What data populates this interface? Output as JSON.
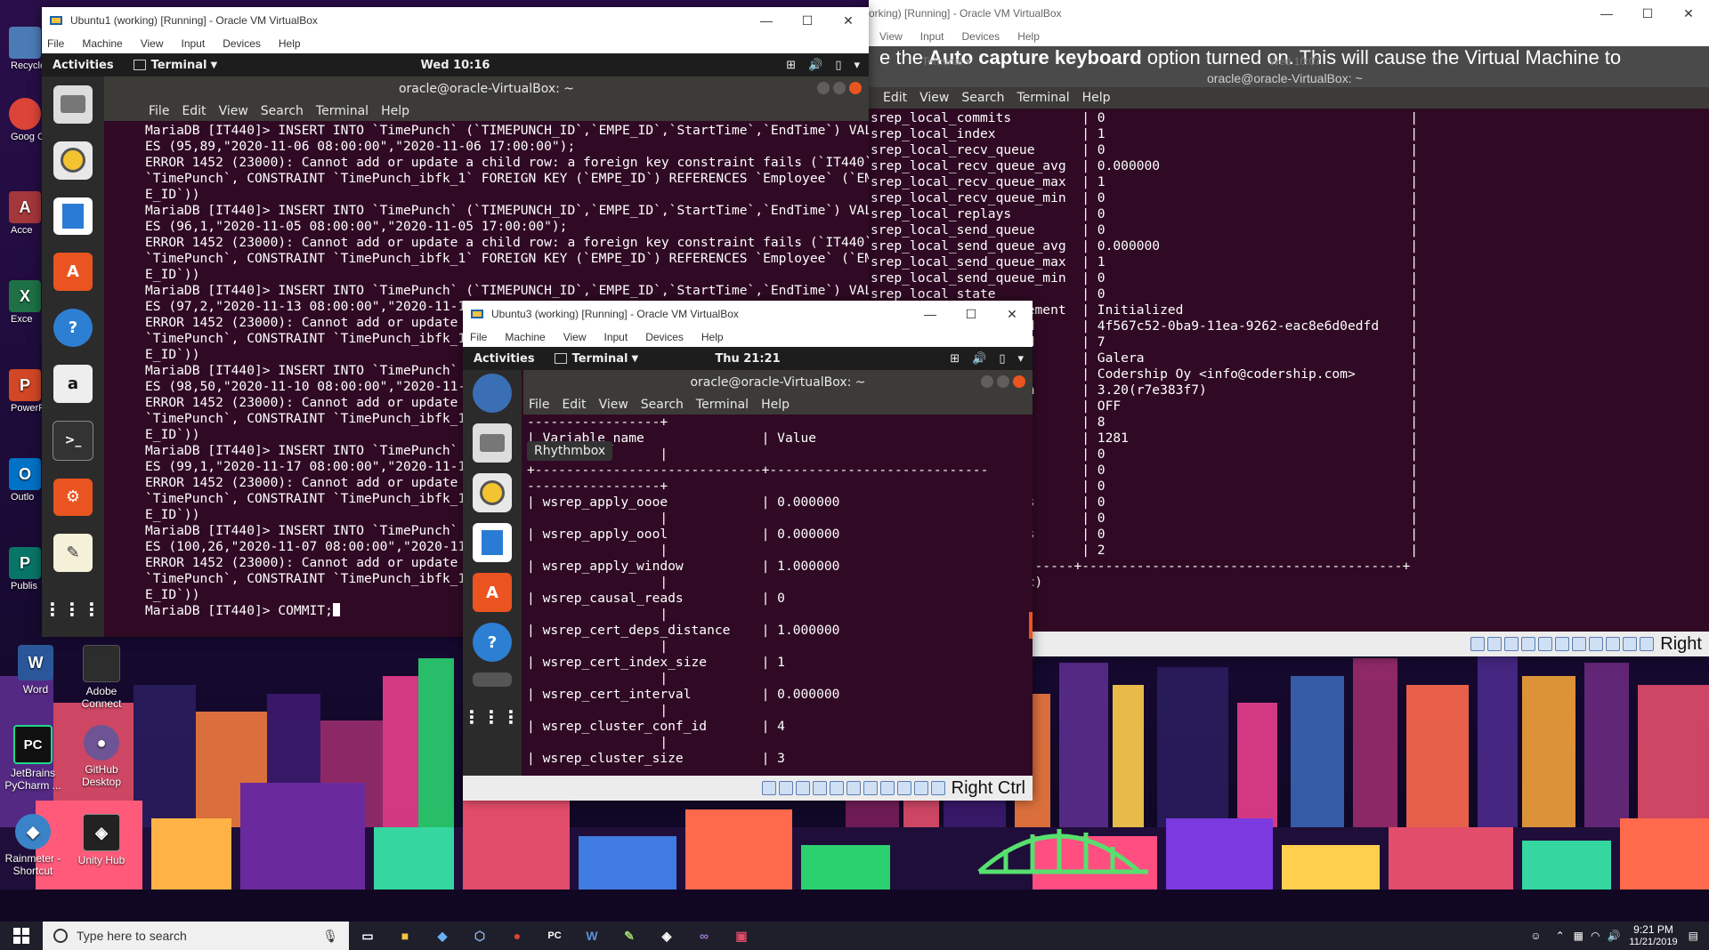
{
  "desktop": {
    "icons_left_partial": [
      {
        "label": "Recycle",
        "name": "recycle-bin-icon",
        "color": "#4b7bb5",
        "glyph": "♻"
      },
      {
        "label": "Goog Chro",
        "name": "chrome-icon",
        "color": "#db4437",
        "glyph": "●"
      },
      {
        "label": "Acce",
        "name": "access-icon",
        "color": "#a4373a",
        "glyph": "A"
      },
      {
        "label": "Exce",
        "name": "excel-icon",
        "color": "#1e7145",
        "glyph": "X"
      },
      {
        "label": "PowerP",
        "name": "powerpoint-icon",
        "color": "#d24726",
        "glyph": "P"
      },
      {
        "label": "Outlo",
        "name": "outlook-icon",
        "color": "#0072c6",
        "glyph": "O"
      },
      {
        "label": "Publis",
        "name": "publisher-icon",
        "color": "#077568",
        "glyph": "P"
      }
    ],
    "icons": [
      {
        "label": "Word",
        "name": "word-icon",
        "color": "#2b579a",
        "glyph": "W"
      },
      {
        "label": "Adobe Connect",
        "name": "adobe-connect-icon",
        "color": "#2d2d2d",
        "glyph": "⬚"
      },
      {
        "label": "JetBrains PyCharm ...",
        "name": "pycharm-icon",
        "color": "#111111",
        "glyph": "PC"
      },
      {
        "label": "GitHub Desktop",
        "name": "github-desktop-icon",
        "color": "#6e5494",
        "glyph": "🐙"
      },
      {
        "label": "Rainmeter - Shortcut",
        "name": "rainmeter-icon",
        "color": "#3a83c9",
        "glyph": "💧"
      },
      {
        "label": "Unity Hub",
        "name": "unity-hub-icon",
        "color": "#222222",
        "glyph": "◈"
      }
    ]
  },
  "win_back": {
    "title": "orking) [Running] - Oracle VM VirtualBox",
    "menu": [
      "View",
      "Input",
      "Devices",
      "Help"
    ],
    "notice_pre": "e the ",
    "notice_bold": "Auto capture keyboard",
    "notice_post": " option turned on. This will cause the Virtual Machine to",
    "ghost_terminal": "Terminal ▾",
    "ghost_clock": "Wed 10:07",
    "term_title": "oracle@oracle-VirtualBox: ~",
    "term_menu": [
      "Edit",
      "View",
      "Search",
      "Terminal",
      "Help"
    ],
    "lines": [
      "srep_local_commits         | 0                                       |",
      "srep_local_index           | 1                                       |",
      "srep_local_recv_queue      | 0                                       |",
      "srep_local_recv_queue_avg  | 0.000000                                |",
      "srep_local_recv_queue_max  | 1                                       |",
      "srep_local_recv_queue_min  | 0                                       |",
      "srep_local_replays         | 0                                       |",
      "srep_local_send_queue      | 0                                       |",
      "srep_local_send_queue_avg  | 0.000000                                |",
      "srep_local_send_queue_max  | 1                                       |",
      "srep_local_send_queue_min  | 0                                       |",
      "srep_local_state           | 0                                       |",
      "                    ement  | Initialized                             |",
      "                    d      | 4f567c52-0ba9-11ea-9262-eac8e6d0edfd    |",
      "                    d      | 7                                       |",
      "                           | Galera                                  |",
      "                           | Codership Oy <info@codership.com>       |",
      "                    n      | 3.20(r7e383f7)                          |",
      "                           | OFF                                     |",
      "                           | 8                                       |",
      "                           | 1281                                    |",
      "                           | 0                                       |",
      "                           | 0                                       |",
      "                           | 0                                       |",
      "                    s      | 0                                       |",
      "                           | 0                                       |",
      "                    s      | 0                                       |",
      "                           | 2                                       |",
      "--------------------------+-----------------------------------------+",
      "                    c)"
    ],
    "host_key": "Right"
  },
  "win1": {
    "title": "Ubuntu1 (working) [Running] - Oracle VM VirtualBox",
    "menu": [
      "File",
      "Machine",
      "View",
      "Input",
      "Devices",
      "Help"
    ],
    "activities": "Activities",
    "app_menu": "Terminal",
    "clock": "Wed 10:16",
    "term_title": "oracle@oracle-VirtualBox: ~",
    "term_menu": [
      "File",
      "Edit",
      "View",
      "Search",
      "Terminal",
      "Help"
    ],
    "lines": [
      "MariaDB [IT440]> INSERT INTO `TimePunch` (`TIMEPUNCH_ID`,`EMPE_ID`,`StartTime`,`EndTime`) VALU",
      "ES (95,89,\"2020-11-06 08:00:00\",\"2020-11-06 17:00:00\");",
      "ERROR 1452 (23000): Cannot add or update a child row: a foreign key constraint fails (`IT440`.",
      "`TimePunch`, CONSTRAINT `TimePunch_ibfk_1` FOREIGN KEY (`EMPE_ID`) REFERENCES `Employee` (`EMP",
      "E_ID`))",
      "MariaDB [IT440]> INSERT INTO `TimePunch` (`TIMEPUNCH_ID`,`EMPE_ID`,`StartTime`,`EndTime`) VALU",
      "ES (96,1,\"2020-11-05 08:00:00\",\"2020-11-05 17:00:00\");",
      "ERROR 1452 (23000): Cannot add or update a child row: a foreign key constraint fails (`IT440`.",
      "`TimePunch`, CONSTRAINT `TimePunch_ibfk_1` FOREIGN KEY (`EMPE_ID`) REFERENCES `Employee` (`EMP",
      "E_ID`))",
      "MariaDB [IT440]> INSERT INTO `TimePunch` (`TIMEPUNCH_ID`,`EMPE_ID`,`StartTime`,`EndTime`) VALU",
      "ES (97,2,\"2020-11-13 08:00:00\",\"2020-11-13 17",
      "ERROR 1452 (23000): Cannot add or update a ch",
      "`TimePunch`, CONSTRAINT `TimePunch_ibfk_1` FO",
      "E_ID`))",
      "MariaDB [IT440]> INSERT INTO `TimePunch` (`TI",
      "ES (98,50,\"2020-11-10 08:00:00\",\"2020-11-10 1",
      "ERROR 1452 (23000): Cannot add or update a ch",
      "`TimePunch`, CONSTRAINT `TimePunch_ibfk_1` FO",
      "E_ID`))",
      "MariaDB [IT440]> INSERT INTO `TimePunch` (`TI",
      "ES (99,1,\"2020-11-17 08:00:00\",\"2020-11-17 17",
      "ERROR 1452 (23000): Cannot add or update a ch",
      "`TimePunch`, CONSTRAINT `TimePunch_ibfk_1` FO",
      "E_ID`))",
      "MariaDB [IT440]> INSERT INTO `TimePunch` (`TI",
      "ES (100,26,\"2020-11-07 08:00:00\",\"2020-11-07",
      "ERROR 1452 (23000): Cannot add or update a ch",
      "`TimePunch`, CONSTRAINT `TimePunch_ibfk_1` FO",
      "E_ID`))",
      "MariaDB [IT440]> COMMIT;"
    ]
  },
  "win3": {
    "title": "Ubuntu3 (working) [Running] - Oracle VM VirtualBox",
    "menu": [
      "File",
      "Machine",
      "View",
      "Input",
      "Devices",
      "Help"
    ],
    "activities": "Activities",
    "app_menu": "Terminal",
    "clock": "Thu 21:21",
    "term_title": "oracle@oracle-VirtualBox: ~",
    "term_menu": [
      "File",
      "Edit",
      "View",
      "Search",
      "Terminal",
      "Help"
    ],
    "tooltip": "Rhythmbox",
    "lines": [
      "-----------------+",
      "| Variable_name               | Value",
      "                 |",
      "+-----------------------------+----------------------------",
      "-----------------+",
      "| wsrep_apply_oooe            | 0.000000",
      "                 |",
      "| wsrep_apply_oool            | 0.000000",
      "                 |",
      "| wsrep_apply_window          | 1.000000",
      "                 |",
      "| wsrep_causal_reads          | 0",
      "                 |",
      "| wsrep_cert_deps_distance    | 1.000000",
      "                 |",
      "| wsrep_cert_index_size       | 1",
      "                 |",
      "| wsrep_cert_interval         | 0.000000",
      "                 |",
      "| wsrep_cluster_conf_id       | 4",
      "                 |",
      "| wsrep_cluster_size          | 3"
    ],
    "host_key": "Right Ctrl"
  },
  "taskbar": {
    "search_placeholder": "Type here to search",
    "time": "9:21 PM",
    "date": "11/21/2019"
  }
}
